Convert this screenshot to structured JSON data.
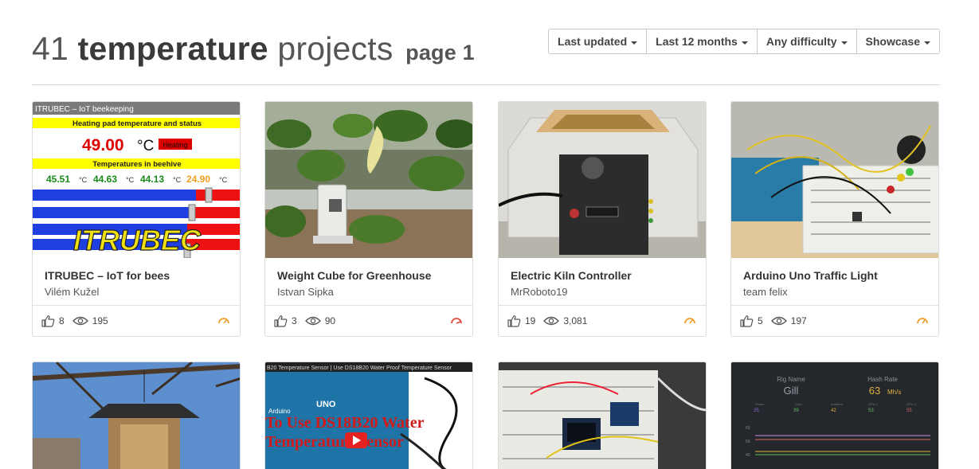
{
  "header": {
    "count": "41",
    "topic": "temperature",
    "suffix": "projects",
    "page_label": "page 1"
  },
  "filters": [
    {
      "label": "Last updated"
    },
    {
      "label": "Last 12 months"
    },
    {
      "label": "Any difficulty"
    },
    {
      "label": "Showcase"
    }
  ],
  "projects": [
    {
      "name": "ITRUBEC – IoT for bees",
      "author": "Vilém Kužel",
      "likes": "8",
      "views": "195",
      "difficulty_color": "#f0a028"
    },
    {
      "name": "Weight Cube for Greenhouse",
      "author": "Istvan Sipka",
      "likes": "3",
      "views": "90",
      "difficulty_color": "#e04b3a"
    },
    {
      "name": "Electric Kiln Controller",
      "author": "MrRoboto19",
      "likes": "19",
      "views": "3,081",
      "difficulty_color": "#f0a028"
    },
    {
      "name": "Arduino Uno Traffic Light",
      "author": "team felix",
      "likes": "5",
      "views": "197",
      "difficulty_color": "#f0a028"
    }
  ],
  "thumb1": {
    "header": "ITRUBEC – IoT beekeeping",
    "heating_title": "Heating pad temperature and status",
    "heating_value": "49.00",
    "heating_unit": "°C",
    "heating_status": "Heating",
    "hive_title": "Temperatures in beehive",
    "t1": "45.51",
    "t2": "44.63",
    "t3": "44.13",
    "t4": "24.90",
    "unit": "°C",
    "logo": "ITRUBEC"
  },
  "thumb6": {
    "banner": "B20 Temperature Sensor | Use DS18B20 Water Proof Temperature Sensor",
    "overlay_line1": "To Use DS18B20 Water",
    "overlay_line2": "Temperature Sensor",
    "board_brand": "UNO",
    "board_name": "Arduino"
  },
  "thumb8": {
    "label1": "Rig Name",
    "value1": "Gill",
    "label2": "Hash Rate",
    "value2": "63",
    "value2_unit": "Mh/s",
    "m1_label": "Power",
    "m1_value": "25",
    "m2_label": "Core",
    "m2_value": "39",
    "m3_label": "Ambient",
    "m3_value": "42",
    "m4_label": "GPU 1",
    "m4_value": "53",
    "m5_label": "GPU 2",
    "m5_value": "55",
    "metric_unit": "°C",
    "axis_60": "60",
    "axis_50": "50",
    "axis_40": "40"
  }
}
